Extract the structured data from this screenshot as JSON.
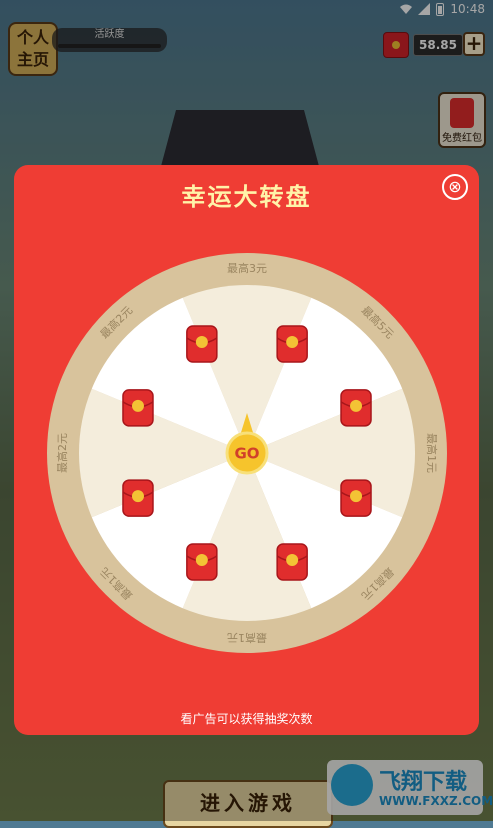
{
  "status_bar": {
    "time": "10:48"
  },
  "header": {
    "logo_line1": "个人",
    "logo_line2": "主页",
    "activity_label": "活跃度",
    "balance": "58.85",
    "add_label": "+",
    "free_hongbao_label": "免费红包"
  },
  "dialog": {
    "title": "幸运大转盘",
    "close_label": "⊗",
    "hint": "看广告可以获得抽奖次数",
    "go_label": "GO",
    "segments": [
      {
        "label": "最高3元"
      },
      {
        "label": "最高5元"
      },
      {
        "label": "最高1元"
      },
      {
        "label": "最高1元"
      },
      {
        "label": "最高1元"
      },
      {
        "label": "最高1元"
      },
      {
        "label": "最高2元"
      },
      {
        "label": "最高2元"
      }
    ]
  },
  "bottom": {
    "enter_label": "进入游戏"
  },
  "watermark": {
    "title": "飞翔下载",
    "url": "WWW.FXXZ.COM"
  },
  "colors": {
    "dialog_bg": "#ef3d34",
    "rim": "#d8c39c",
    "seg_light": "#ffffff",
    "seg_cream": "#f4eddc",
    "envelope": "#e02d2d",
    "coin": "#f3c335"
  }
}
